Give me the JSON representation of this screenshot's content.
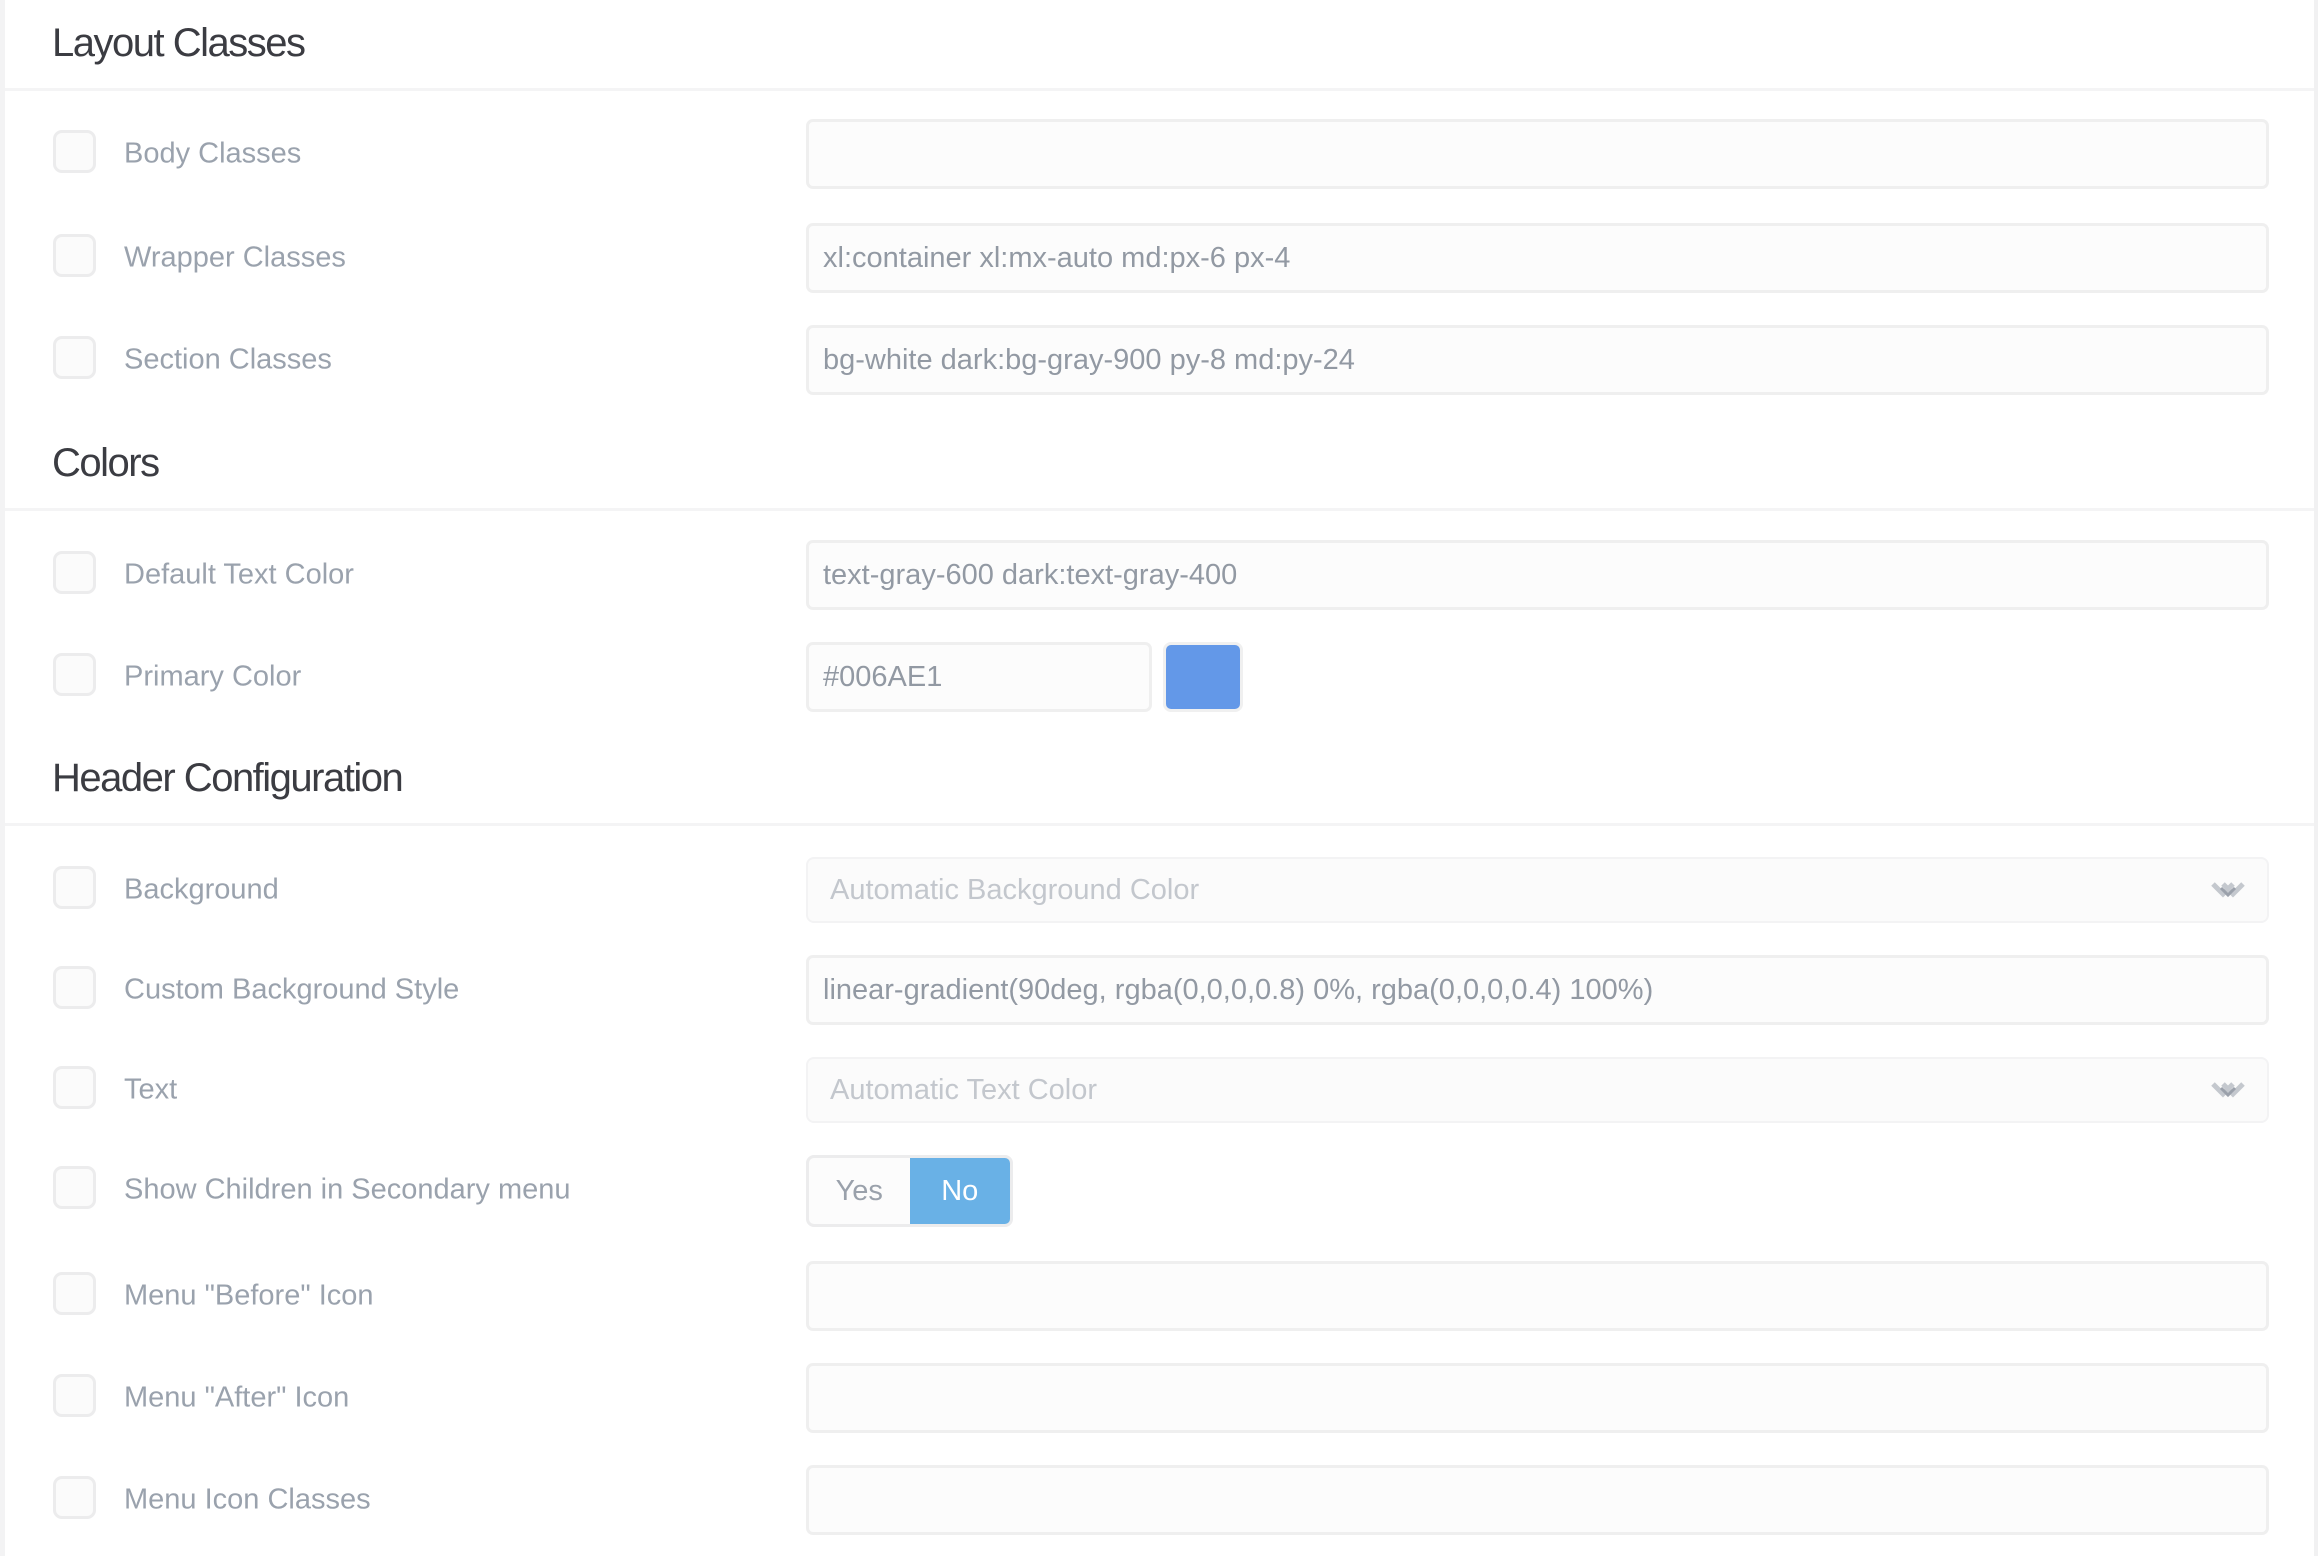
{
  "sections": [
    {
      "title": "Layout Classes",
      "fields": [
        {
          "label": "Body Classes",
          "type": "text",
          "value": ""
        },
        {
          "label": "Wrapper Classes",
          "type": "text",
          "value": "xl:container xl:mx-auto md:px-6 px-4"
        },
        {
          "label": "Section Classes",
          "type": "text",
          "value": "bg-white dark:bg-gray-900 py-8 md:py-24"
        }
      ]
    },
    {
      "title": "Colors",
      "fields": [
        {
          "label": "Default Text Color",
          "type": "text",
          "value": "text-gray-600 dark:text-gray-400"
        },
        {
          "label": "Primary Color",
          "type": "color",
          "value": "#006AE1",
          "swatch_color": "#6398E8"
        }
      ]
    },
    {
      "title": "Header Configuration",
      "fields": [
        {
          "label": "Background",
          "type": "select",
          "value": "Automatic Background Color",
          "icon": "chevron-down-icon"
        },
        {
          "label": "Custom Background Style",
          "type": "text",
          "value": "linear-gradient(90deg, rgba(0,0,0,0.8) 0%, rgba(0,0,0,0.4) 100%)"
        },
        {
          "label": "Text",
          "type": "select",
          "value": "Automatic Text Color",
          "icon": "chevron-down-icon"
        },
        {
          "label": "Show Children in Secondary menu",
          "type": "toggle",
          "options": [
            "Yes",
            "No"
          ],
          "selected": "No",
          "active_color": "#69B1E6"
        },
        {
          "label": "Menu \"Before\" Icon",
          "type": "text",
          "value": ""
        },
        {
          "label": "Menu \"After\" Icon",
          "type": "text",
          "value": ""
        },
        {
          "label": "Menu Icon Classes",
          "type": "text",
          "value": ""
        }
      ]
    }
  ]
}
